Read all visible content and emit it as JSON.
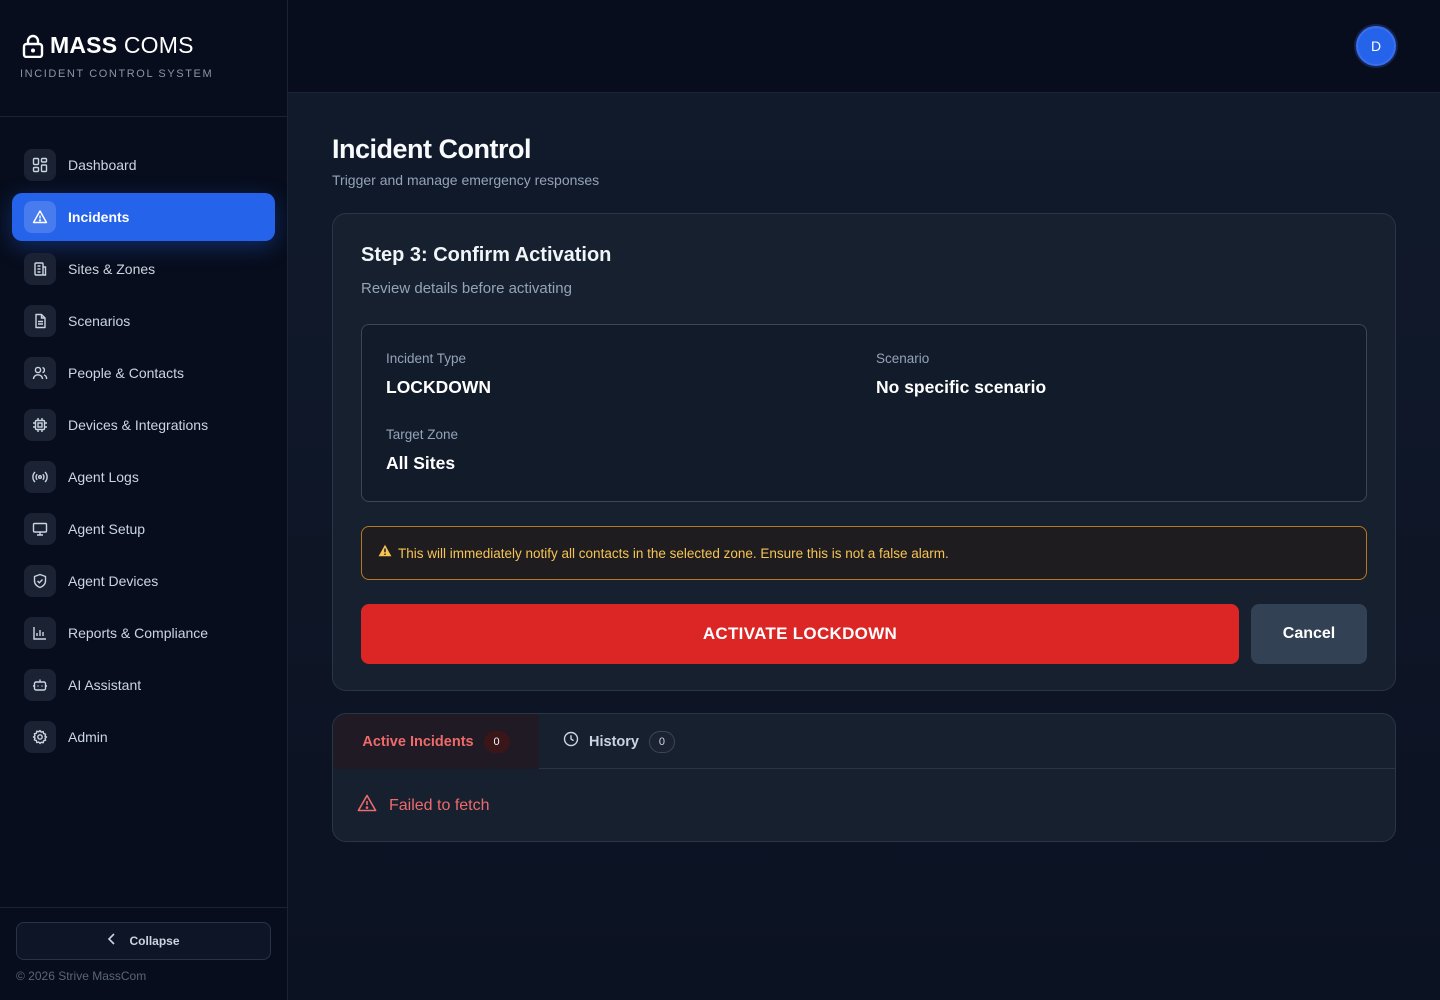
{
  "brand": {
    "name_bold": "MASS",
    "name_regular": "COMS",
    "subtitle": "INCIDENT CONTROL SYSTEM"
  },
  "sidebar": {
    "items": [
      {
        "label": "Dashboard",
        "icon": "dashboard-icon",
        "active": false
      },
      {
        "label": "Incidents",
        "icon": "alert-triangle-icon",
        "active": true
      },
      {
        "label": "Sites & Zones",
        "icon": "building-icon",
        "active": false
      },
      {
        "label": "Scenarios",
        "icon": "document-icon",
        "active": false
      },
      {
        "label": "People & Contacts",
        "icon": "users-icon",
        "active": false
      },
      {
        "label": "Devices & Integrations",
        "icon": "chip-icon",
        "active": false
      },
      {
        "label": "Agent Logs",
        "icon": "broadcast-icon",
        "active": false
      },
      {
        "label": "Agent Setup",
        "icon": "monitor-icon",
        "active": false
      },
      {
        "label": "Agent Devices",
        "icon": "shield-check-icon",
        "active": false
      },
      {
        "label": "Reports & Compliance",
        "icon": "bar-chart-icon",
        "active": false
      },
      {
        "label": "AI Assistant",
        "icon": "bot-icon",
        "active": false
      },
      {
        "label": "Admin",
        "icon": "gear-icon",
        "active": false
      }
    ],
    "collapse_label": "Collapse",
    "copyright": "© 2026 Strive MassCom"
  },
  "topbar": {
    "avatar_initial": "D"
  },
  "page": {
    "title": "Incident Control",
    "subtitle": "Trigger and manage emergency responses"
  },
  "confirm": {
    "step_title": "Step 3: Confirm Activation",
    "step_subtitle": "Review details before activating",
    "incident_type_label": "Incident Type",
    "incident_type_value": "LOCKDOWN",
    "scenario_label": "Scenario",
    "scenario_value": "No specific scenario",
    "target_zone_label": "Target Zone",
    "target_zone_value": "All Sites",
    "warning": "This will immediately notify all contacts in the selected zone. Ensure this is not a false alarm.",
    "activate_label": "ACTIVATE LOCKDOWN",
    "cancel_label": "Cancel"
  },
  "tabs": {
    "active_label": "Active Incidents",
    "active_count": "0",
    "history_label": "History",
    "history_count": "0",
    "error_text": "Failed to fetch"
  },
  "colors": {
    "accent": "#2563eb",
    "danger": "#dc2626",
    "warning": "#f6c453"
  }
}
